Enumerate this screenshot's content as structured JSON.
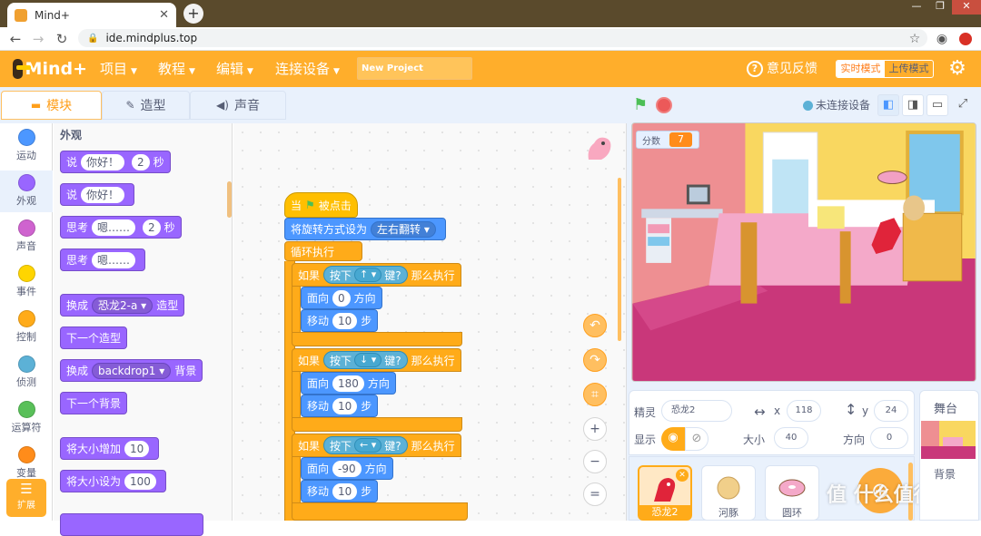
{
  "browser": {
    "tab_title": "Mind+",
    "tab_close": "✕",
    "new_tab": "+",
    "url": "ide.mindplus.top",
    "window_controls": [
      "—",
      "❐",
      "✕"
    ]
  },
  "app": {
    "logo_text": "Mind+",
    "menu": [
      {
        "label": "项目"
      },
      {
        "label": "教程"
      },
      {
        "label": "编辑"
      },
      {
        "label": "连接设备"
      }
    ],
    "project_name": "New Project",
    "feedback": "意见反馈",
    "mode_realtime": "实时模式",
    "mode_upload": "上传模式"
  },
  "editor_tabs": {
    "blocks": "模块",
    "costumes": "造型",
    "sounds": "声音"
  },
  "connection_status": "未连接设备",
  "categories": [
    {
      "label": "运动",
      "color": "#4c97ff"
    },
    {
      "label": "外观",
      "color": "#9966ff"
    },
    {
      "label": "声音",
      "color": "#cf63cf"
    },
    {
      "label": "事件",
      "color": "#ffd500"
    },
    {
      "label": "控制",
      "color": "#ffab19"
    },
    {
      "label": "侦测",
      "color": "#5cb1d6"
    },
    {
      "label": "运算符",
      "color": "#59c059"
    },
    {
      "label": "变量",
      "color": "#ff8c1a"
    }
  ],
  "extensions_label": "扩展",
  "palette": {
    "title": "外观",
    "say_secs": {
      "w1": "说",
      "text": "你好！",
      "secs": "2",
      "w2": "秒"
    },
    "say": {
      "w1": "说",
      "text": "你好！"
    },
    "think_secs": {
      "w1": "思考",
      "text": "嗯……",
      "secs": "2",
      "w2": "秒"
    },
    "think": {
      "w1": "思考",
      "text": "嗯……"
    },
    "switch_costume": {
      "w1": "换成",
      "value": "恐龙2-a",
      "w2": "造型"
    },
    "next_costume": "下一个造型",
    "switch_backdrop": {
      "w1": "换成",
      "value": "backdrop1",
      "w2": "背景"
    },
    "next_backdrop": "下一个背景",
    "change_size": {
      "w1": "将大小增加",
      "value": "10"
    },
    "set_size": {
      "w1": "将大小设为",
      "value": "100"
    }
  },
  "script": {
    "hat": {
      "w1": "当",
      "w2": "被点击"
    },
    "rotation": {
      "w1": "将旋转方式设为",
      "value": "左右翻转"
    },
    "forever": "循环执行",
    "if_blocks": [
      {
        "if": "如果",
        "press": "按下",
        "key": "↑",
        "key_q": "键?",
        "then": "那么执行",
        "point": "面向",
        "dir": "0",
        "dir_w": "方向",
        "move": "移动",
        "steps": "10",
        "steps_w": "步"
      },
      {
        "if": "如果",
        "press": "按下",
        "key": "↓",
        "key_q": "键?",
        "then": "那么执行",
        "point": "面向",
        "dir": "180",
        "dir_w": "方向",
        "move": "移动",
        "steps": "10",
        "steps_w": "步"
      },
      {
        "if": "如果",
        "press": "按下",
        "key": "←",
        "key_q": "键?",
        "then": "那么执行",
        "point": "面向",
        "dir": "-90",
        "dir_w": "方向",
        "move": "移动",
        "steps": "10",
        "steps_w": "步"
      }
    ]
  },
  "stage": {
    "score_label": "分数",
    "score_value": "7"
  },
  "sprite_info": {
    "sprite_label": "精灵",
    "sprite_name": "恐龙2",
    "x_label": "x",
    "x_value": "118",
    "y_label": "y",
    "y_value": "24",
    "show_label": "显示",
    "size_label": "大小",
    "size_value": "40",
    "direction_label": "方向",
    "direction_value": "0"
  },
  "sprites": [
    {
      "name": "恐龙2"
    },
    {
      "name": "河豚"
    },
    {
      "name": "圆环"
    }
  ],
  "stage_panel": {
    "title": "舞台",
    "backdrop_label": "背景"
  },
  "watermark": "值 什么值得买"
}
